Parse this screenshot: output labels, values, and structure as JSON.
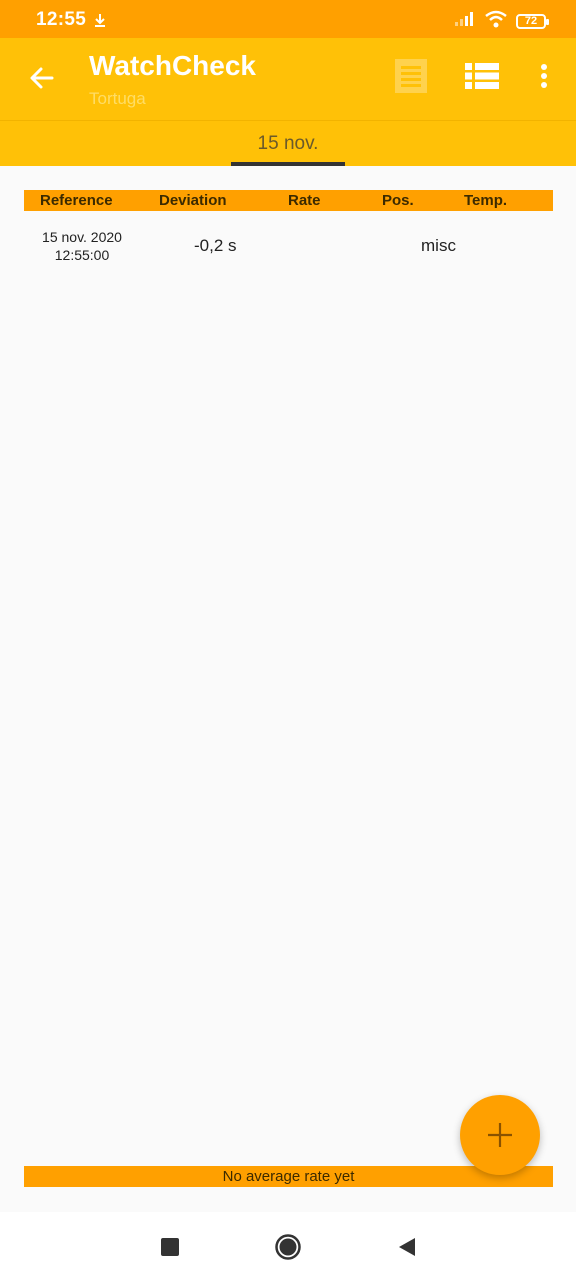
{
  "status_bar": {
    "time": "12:55",
    "battery": "72"
  },
  "app_bar": {
    "title": "WatchCheck",
    "subtitle": "Tortuga"
  },
  "tabs": [
    {
      "label": "15 nov.",
      "selected": true
    }
  ],
  "table": {
    "columns": [
      "Reference",
      "Deviation",
      "Rate",
      "Pos.",
      "Temp."
    ],
    "rows": [
      {
        "reference_date": "15 nov. 2020",
        "reference_time": "12:55:00",
        "deviation": "-0,2 s",
        "rate": "",
        "position": "misc",
        "temperature": ""
      }
    ]
  },
  "footer": {
    "text": "No average rate yet"
  },
  "colors": {
    "accent": "#ffa000",
    "primary": "#ffc107",
    "text_dark": "#3b2a00"
  },
  "icons": [
    "download-icon",
    "signal-icon",
    "wifi-icon",
    "battery-icon",
    "back-arrow-icon",
    "list-view-icon",
    "detailed-list-icon",
    "more-vert-icon",
    "add-icon",
    "recents-icon",
    "home-icon",
    "back-icon"
  ]
}
